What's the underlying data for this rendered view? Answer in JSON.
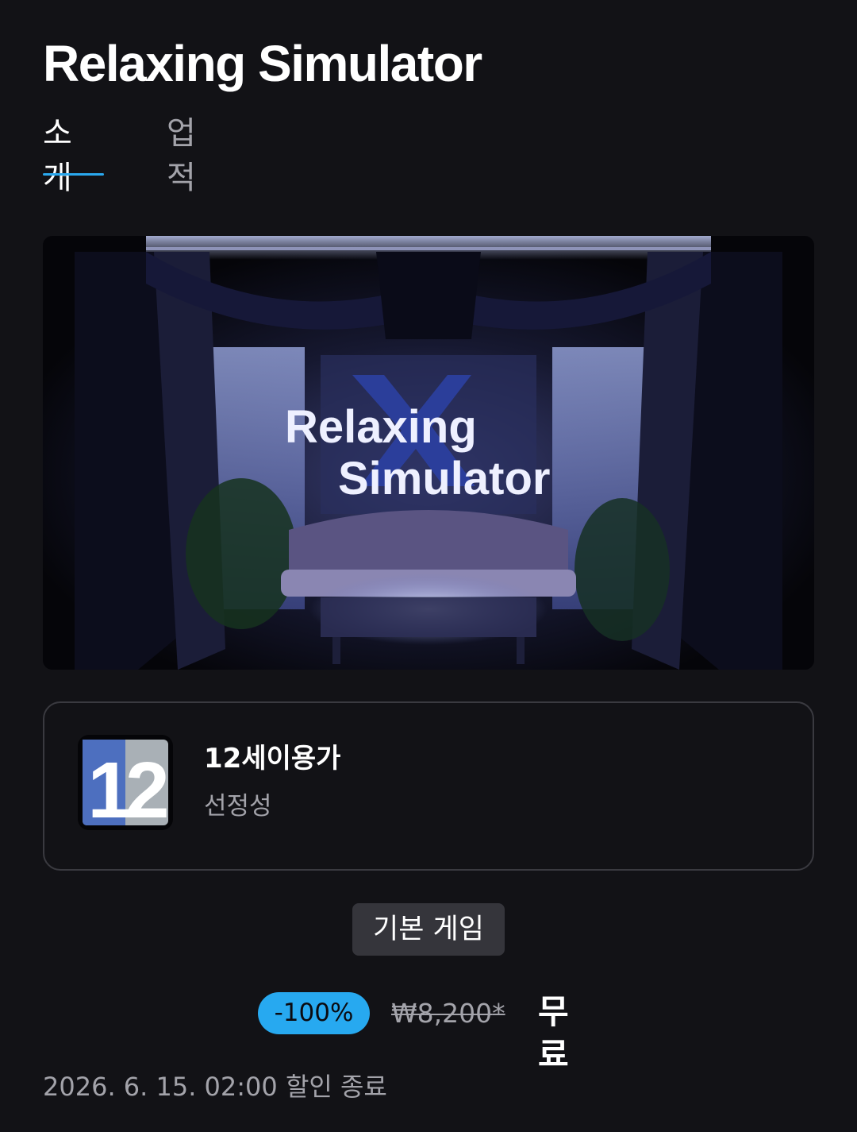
{
  "game": {
    "title": "Relaxing Simulator"
  },
  "tabs": [
    {
      "label": "소개",
      "active": true
    },
    {
      "label": "업적",
      "active": false
    }
  ],
  "hero": {
    "logo_line1": "Relaxing",
    "logo_line2": "Simulator"
  },
  "rating": {
    "icon": "age-12-rating-icon",
    "icon_text": "12",
    "title": "12세이용가",
    "descriptor": "선정성"
  },
  "game_type": "기본 게임",
  "price": {
    "discount": "-100%",
    "original": "₩8,200",
    "original_marker": "*",
    "final": "무료"
  },
  "sale_end": "2026. 6. 15. 02:00 할인 종료",
  "colors": {
    "background": "#121216",
    "accent": "#2aa8ee",
    "muted_text": "#a3a3aa",
    "badge_bg": "#35353b"
  }
}
